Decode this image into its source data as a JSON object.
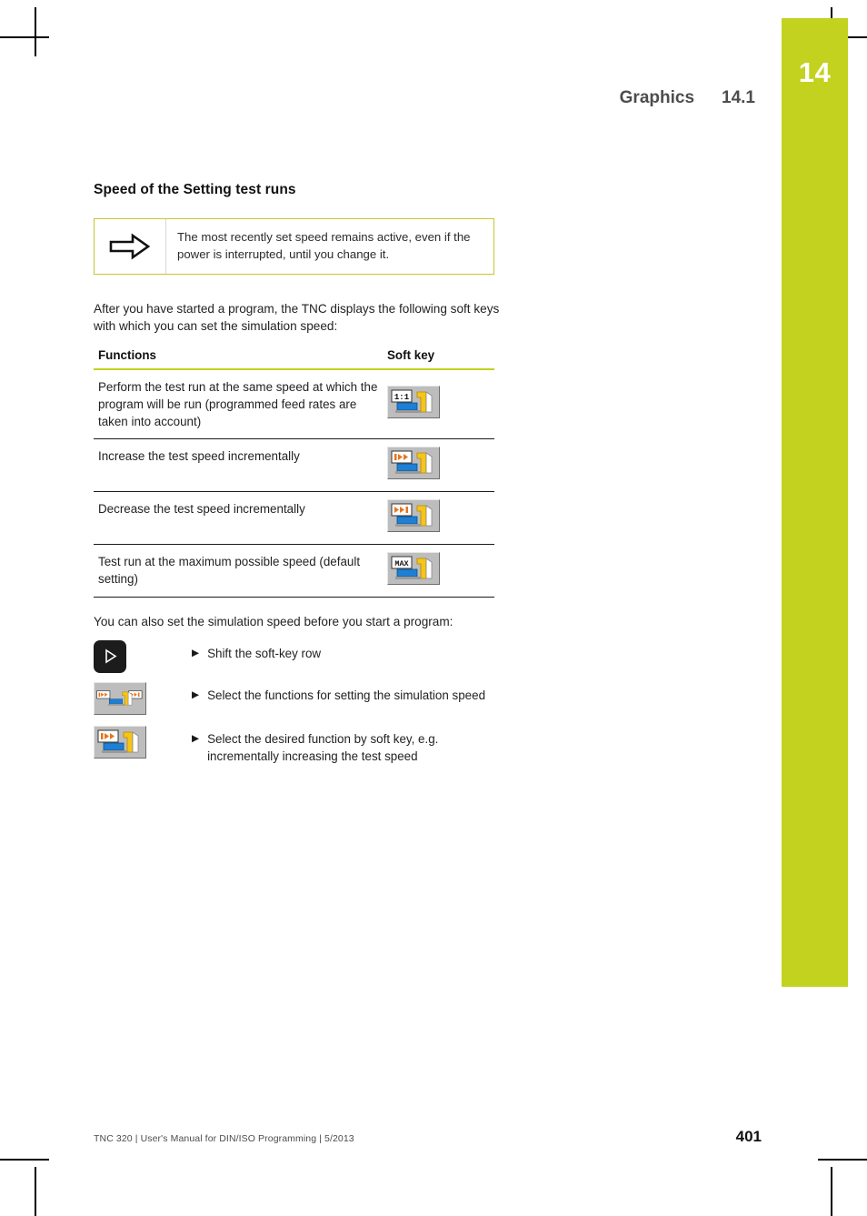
{
  "chapter_tab": {
    "number": "14",
    "color": "#c3d11f"
  },
  "running_head": {
    "title": "Graphics",
    "section": "14.1"
  },
  "section": {
    "title": "Speed of the Setting test runs"
  },
  "note": {
    "icon": "arrow-right-outline-icon",
    "text": "The most recently set speed remains active, even if the power is interrupted, until you change it.",
    "border_color": "#c9c62c"
  },
  "intro_paragraph": "After you have started a program, the TNC displays the following soft keys with which you can set the simulation speed:",
  "table": {
    "headers": {
      "functions": "Functions",
      "softkey": "Soft key"
    },
    "rows": [
      {
        "function": "Perform the test run at the same speed at which the program will be run (programmed feed rates are taken into account)",
        "softkey_icon": "softkey-speed-1to1-icon",
        "badge": "1:1",
        "badge_type": "text"
      },
      {
        "function": "Increase the test speed incrementally",
        "softkey_icon": "softkey-speed-increase-icon",
        "badge": "",
        "badge_type": "arrows-increase"
      },
      {
        "function": "Decrease the test speed incrementally",
        "softkey_icon": "softkey-speed-decrease-icon",
        "badge": "",
        "badge_type": "arrows-decrease"
      },
      {
        "function": "Test run at the maximum possible speed (default setting)",
        "softkey_icon": "softkey-speed-max-icon",
        "badge": "MAX",
        "badge_type": "text"
      }
    ]
  },
  "pre_procedure_paragraph": "You can also set the simulation speed before you start a program:",
  "procedure": {
    "steps": [
      {
        "key_icon": "shift-softkey-row-icon",
        "key_type": "shift",
        "text": "Shift the soft-key row"
      },
      {
        "key_icon": "softkey-speed-functions-icon",
        "key_type": "wide-dual",
        "text": "Select the functions for setting the simulation speed"
      },
      {
        "key_icon": "softkey-speed-increase-icon",
        "key_type": "single-increase",
        "text": "Select the desired function by soft key, e.g. incrementally increasing the test speed"
      }
    ]
  },
  "footer": {
    "imprint": "TNC 320 | User's Manual for DIN/ISO Programming | 5/2013",
    "page_number": "401"
  }
}
